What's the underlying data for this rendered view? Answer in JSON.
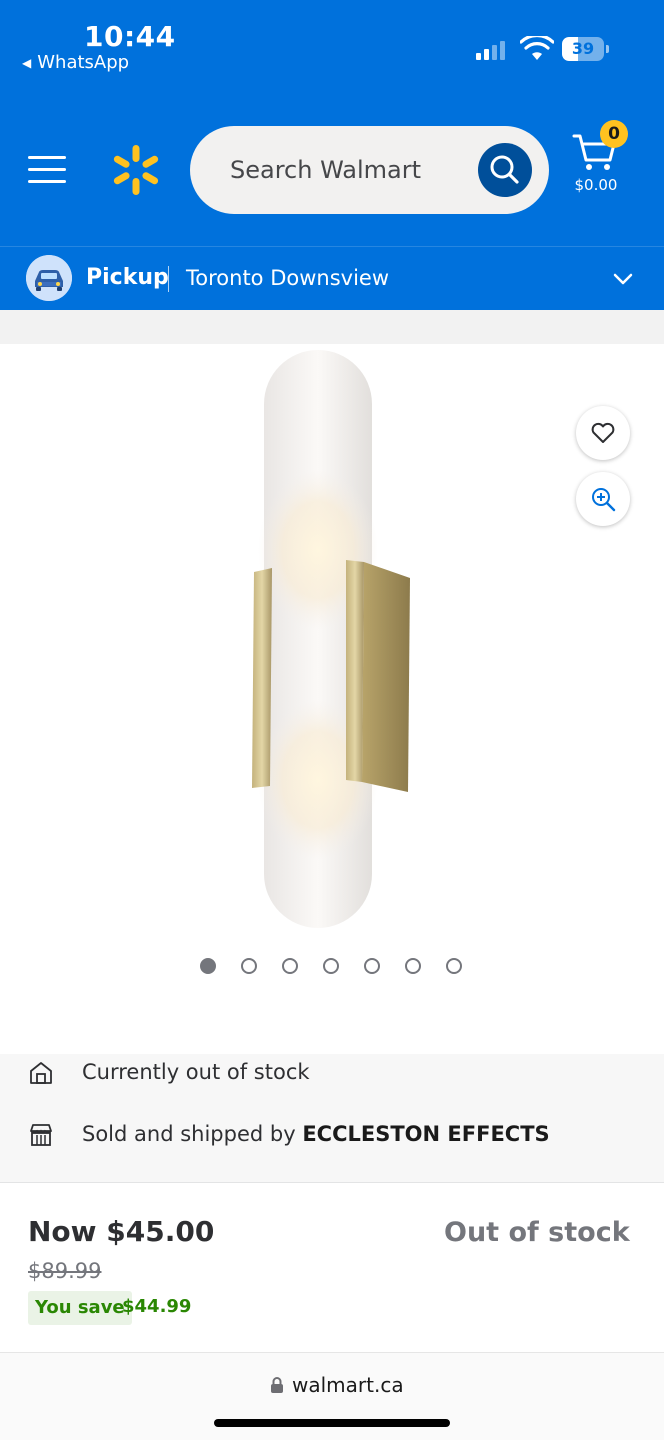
{
  "status_bar": {
    "time": "10:44",
    "back_app": "WhatsApp",
    "battery_level": "39",
    "battery_fraction": 0.39
  },
  "header": {
    "search_placeholder": "Search Walmart",
    "cart_count": "0",
    "cart_total": "$0.00",
    "brand_color": "#0071dc",
    "spark_color": "#ffc220"
  },
  "pickup": {
    "mode": "Pickup",
    "store": "Toronto Downsview"
  },
  "product": {
    "image_icon": "wall-sconce-image",
    "carousel_count": 7,
    "carousel_active_index": 0
  },
  "fulfillment": {
    "stock_message": "Currently out of stock",
    "sold_by_prefix": "Sold and shipped by",
    "seller": "ECCLESTON EFFECTS"
  },
  "price": {
    "now": "Now $45.00",
    "was": "$89.99",
    "you_save_label": "You save",
    "save_amount": "$44.99",
    "availability": "Out of stock"
  },
  "browser": {
    "url": "walmart.ca"
  }
}
